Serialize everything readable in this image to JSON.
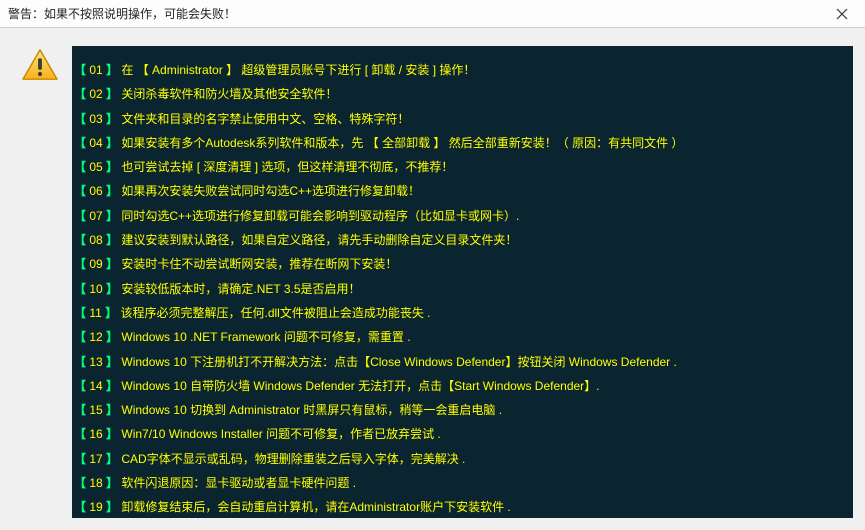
{
  "titlebar": {
    "text": "警告：如果不按照说明操作，可能会失败！"
  },
  "messages": [
    {
      "num": "01",
      "text": "在 【 Administrator 】 超级管理员账号下进行 [ 卸载 / 安装 ] 操作！"
    },
    {
      "num": "02",
      "text": "关闭杀毒软件和防火墙及其他安全软件！"
    },
    {
      "num": "03",
      "text": "文件夹和目录的名字禁止使用中文、空格、特殊字符！"
    },
    {
      "num": "04",
      "text": "如果安装有多个Autodesk系列软件和版本，先 【 全部卸载 】 然后全部重新安装！（ 原因：有共同文件 ）"
    },
    {
      "num": "05",
      "text": "也可尝试去掉 [ 深度清理 ] 选项，但这样清理不彻底，不推荐！"
    },
    {
      "num": "06",
      "text": "如果再次安装失败尝试同时勾选C++选项进行修复卸载！"
    },
    {
      "num": "07",
      "text": "同时勾选C++选项进行修复卸载可能会影响到驱动程序（比如显卡或网卡）."
    },
    {
      "num": "08",
      "text": "建议安装到默认路径，如果自定义路径，请先手动删除自定义目录文件夹！"
    },
    {
      "num": "09",
      "text": "安装时卡住不动尝试断网安装，推荐在断网下安装！"
    },
    {
      "num": "10",
      "text": "安装较低版本时，请确定.NET 3.5是否启用！"
    },
    {
      "num": "11",
      "text": "该程序必须完整解压，任何.dll文件被阻止会造成功能丧失 ."
    },
    {
      "num": "12",
      "text": "Windows 10 .NET Framework 问题不可修复，需重置 ."
    },
    {
      "num": "13",
      "text": "Windows 10 下注册机打不开解决方法：点击【Close Windows Defender】按钮关闭 Windows Defender ."
    },
    {
      "num": "14",
      "text": "Windows 10 自带防火墙 Windows Defender 无法打开，点击【Start Windows Defender】."
    },
    {
      "num": "15",
      "text": "Windows 10 切换到 Administrator 时黑屏只有鼠标，稍等一会重启电脑 ."
    },
    {
      "num": "16",
      "text": "Win7/10 Windows Installer 问题不可修复，作者已放弃尝试 ."
    },
    {
      "num": "17",
      "text": "CAD字体不显示或乱码，物理删除重装之后导入字体，完美解决 ."
    },
    {
      "num": "18",
      "text": "软件闪退原因：显卡驱动或者显卡硬件问题 ."
    },
    {
      "num": "19",
      "text": "卸载修复结束后，会自动重启计算机，请在Administrator账户下安装软件 ."
    }
  ]
}
